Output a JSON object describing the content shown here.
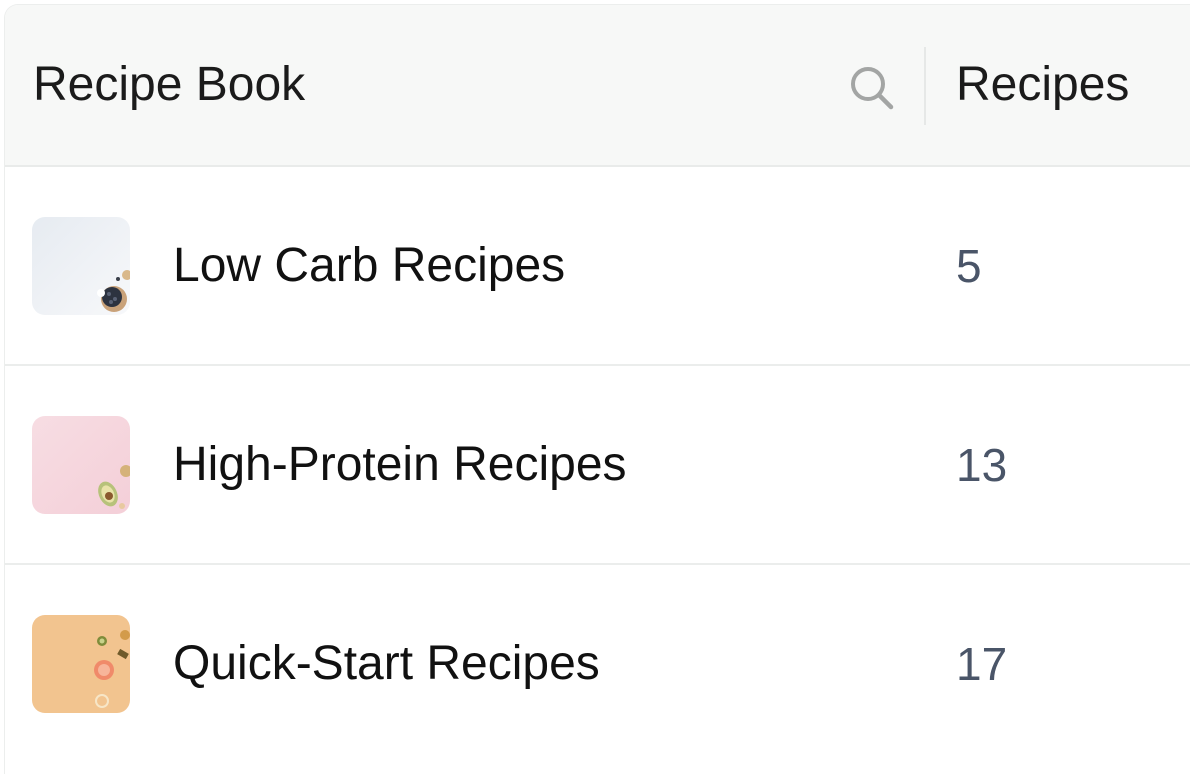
{
  "header": {
    "title": "Recipe Book",
    "search_icon": "search-icon",
    "column_label": "Recipes"
  },
  "rows": [
    {
      "name": "Low Carb Recipes",
      "count": "5",
      "thumbnail": "low-carb-thumbnail",
      "thumb_color": "#eef1f5"
    },
    {
      "name": "High-Protein Recipes",
      "count": "13",
      "thumbnail": "high-protein-thumbnail",
      "thumb_color": "#f6d7df"
    },
    {
      "name": "Quick-Start Recipes",
      "count": "17",
      "thumbnail": "quick-start-thumbnail",
      "thumb_color": "#f2c48f"
    }
  ],
  "colors": {
    "header_bg": "#f7f8f7",
    "text": "#1b1b1b",
    "count_text": "#4a5568",
    "icon_gray": "#a3a5a4",
    "divider": "#ebedec"
  }
}
